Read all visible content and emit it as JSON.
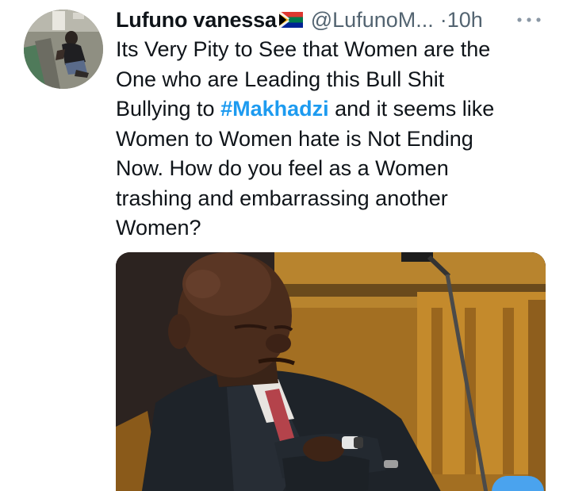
{
  "tweet": {
    "display_name": "Lufuno vanessa",
    "flag_icon": "south-africa-flag-icon",
    "handle": "@LufunoM...",
    "separator": "·",
    "timestamp": "10h",
    "more_icon": "more-dots-icon",
    "text": {
      "line1": "Its Very Pity to See that Women are the",
      "line2": "One who are Leading this Bull Shit",
      "line3_before": "Bullying to ",
      "hashtag": "#Makhadzi",
      "line3_after": " and it seems like",
      "line4": "Women to Women hate is Not Ending",
      "line5": "Now. How do you feel as a Women",
      "line6": "trashing and embarrassing another",
      "line7": "Women?"
    },
    "colors": {
      "hashtag": "#1d9bf0",
      "secondary_text": "#536471",
      "primary_text": "#0f1419"
    }
  }
}
